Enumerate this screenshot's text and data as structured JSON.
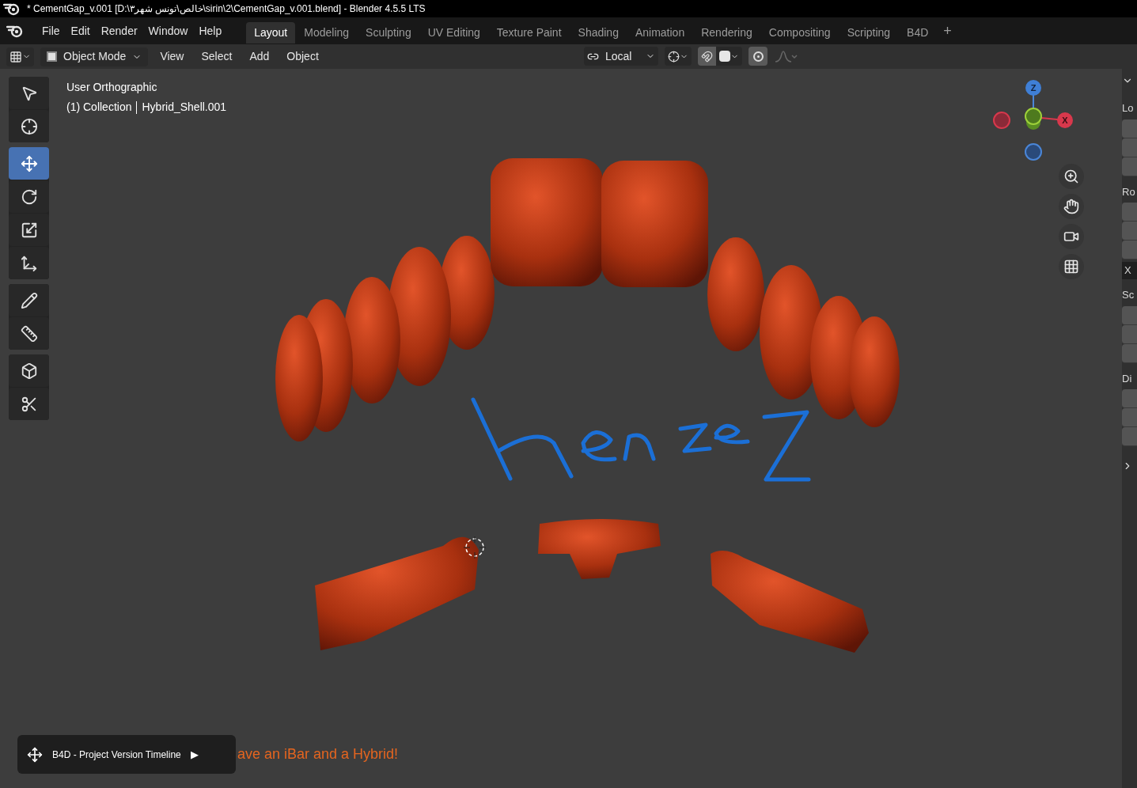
{
  "window": {
    "title": "* CementGap_v.001 [D:\\خالص\\تونس شهر۳\\sirin\\2\\CementGap_v.001.blend] - Blender 4.5.5 LTS"
  },
  "menu": [
    "File",
    "Edit",
    "Render",
    "Window",
    "Help"
  ],
  "workspaces": [
    {
      "label": "Layout",
      "selected": true
    },
    {
      "label": "Modeling",
      "selected": false
    },
    {
      "label": "Sculpting",
      "selected": false
    },
    {
      "label": "UV Editing",
      "selected": false
    },
    {
      "label": "Texture Paint",
      "selected": false
    },
    {
      "label": "Shading",
      "selected": false
    },
    {
      "label": "Animation",
      "selected": false
    },
    {
      "label": "Rendering",
      "selected": false
    },
    {
      "label": "Compositing",
      "selected": false
    },
    {
      "label": "Scripting",
      "selected": false
    },
    {
      "label": "B4D",
      "selected": false
    }
  ],
  "add_workspace": "+",
  "header": {
    "mode": "Object Mode",
    "menus": [
      "View",
      "Select",
      "Add",
      "Object"
    ],
    "orientation": "Local",
    "snap_on": true,
    "proportional_on": true
  },
  "viewport": {
    "view_name": "User Orthographic",
    "collection": "(1) Collection",
    "object": "Hybrid_Shell.001"
  },
  "tool_groups": [
    [
      {
        "kind": "select",
        "selected": false
      },
      {
        "kind": "cursor",
        "selected": false
      }
    ],
    [
      {
        "kind": "move",
        "selected": true
      },
      {
        "kind": "rotate",
        "selected": false
      },
      {
        "kind": "scale",
        "selected": false
      },
      {
        "kind": "transform",
        "selected": false
      }
    ],
    [
      {
        "kind": "annotate",
        "selected": false
      },
      {
        "kind": "measure",
        "selected": false
      }
    ],
    [
      {
        "kind": "add_cube",
        "selected": false
      },
      {
        "kind": "cut",
        "selected": false
      }
    ]
  ],
  "gizmo": {
    "z": "Z",
    "x": "X"
  },
  "side_panel": {
    "sections": [
      {
        "label": "Lo"
      },
      {
        "label": "Ro",
        "axis": "X"
      },
      {
        "label": "Sc"
      },
      {
        "label": "Di"
      }
    ]
  },
  "notification": {
    "text": "B4D - Project Version Timeline",
    "play": "▶",
    "message": "ave an iBar and a Hybrid!"
  }
}
